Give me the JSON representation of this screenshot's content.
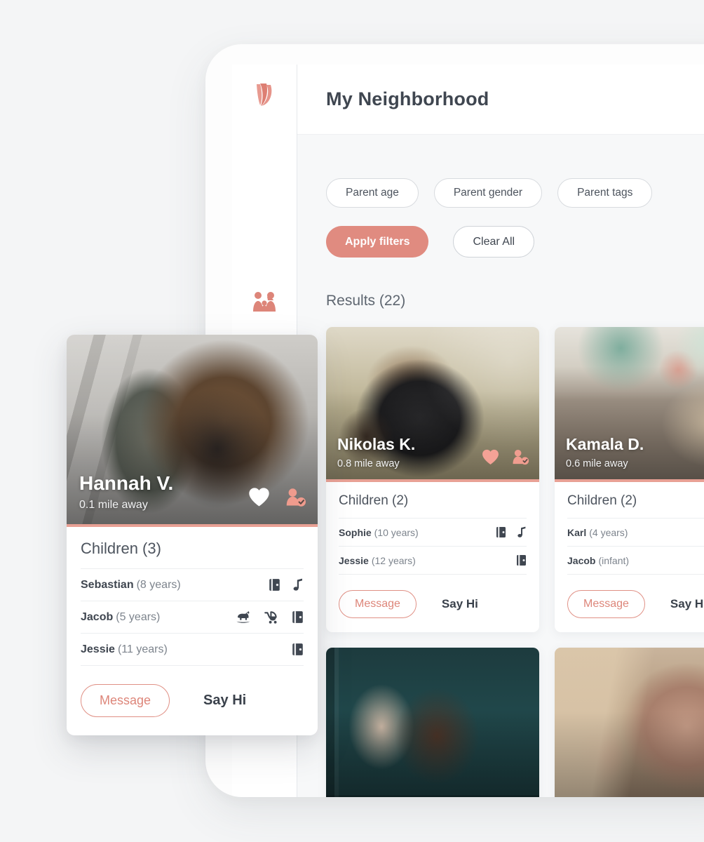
{
  "brand": {
    "accent": "#e08b80",
    "accent_soft": "#e8a094",
    "logo_icon": "tulip-logo-icon",
    "logo_alt": "Tulip logo"
  },
  "sidebar": {
    "items": [
      {
        "icon": "family-icon",
        "label": "Neighborhood",
        "active": true
      }
    ]
  },
  "header": {
    "title": "My Neighborhood"
  },
  "filters": {
    "chips": [
      {
        "label": "Parent age"
      },
      {
        "label": "Parent gender"
      },
      {
        "label": "Parent tags"
      }
    ],
    "apply_label": "Apply filters",
    "clear_label": "Clear All"
  },
  "results": {
    "heading": "Results (22)",
    "count": 22,
    "cards": [
      {
        "name": "Nikolas K.",
        "distance": "0.8 mile away",
        "scene": "scene-field",
        "favorited": true,
        "heart_color": "#f4a296",
        "verified": true,
        "children_heading": "Children (2)",
        "children": [
          {
            "name": "Sophie",
            "age": "(10 years)",
            "icons": [
              "book-icon",
              "music-note-icon"
            ]
          },
          {
            "name": "Jessie",
            "age": "(12 years)",
            "icons": [
              "book-icon"
            ]
          }
        ],
        "message_label": "Message",
        "sayhi_label": "Say Hi"
      },
      {
        "name": "Kamala D.",
        "distance": "0.6 mile away",
        "scene": "scene-livingroom",
        "favorited": false,
        "heart_color": "#ffffff",
        "verified": false,
        "children_heading": "Children (2)",
        "children": [
          {
            "name": "Karl",
            "age": "(4 years)",
            "icons": []
          },
          {
            "name": "Jacob",
            "age": "(infant)",
            "icons": []
          }
        ],
        "message_label": "Message",
        "sayhi_label": "Say Hi"
      },
      {
        "name": "",
        "distance": "",
        "scene": "scene-door",
        "favorited": false,
        "heart_color": "#ffffff",
        "verified": false,
        "children_heading": "",
        "children": [],
        "message_label": "",
        "sayhi_label": ""
      },
      {
        "name": "",
        "distance": "",
        "scene": "scene-portrait",
        "favorited": false,
        "heart_color": "#ffffff",
        "verified": false,
        "children_heading": "",
        "children": [],
        "message_label": "",
        "sayhi_label": ""
      }
    ]
  },
  "featured": {
    "name": "Hannah V.",
    "distance": "0.1 mile away",
    "scene": "scene-street",
    "favorited": true,
    "heart_color": "#ffffff",
    "verified": true,
    "children_heading": "Children (3)",
    "children": [
      {
        "name": "Sebastian",
        "age": "(8 years)",
        "icons": [
          "book-icon",
          "music-note-icon"
        ]
      },
      {
        "name": "Jacob",
        "age": "(5 years)",
        "icons": [
          "rocking-horse-icon",
          "stroller-icon",
          "book-icon"
        ]
      },
      {
        "name": "Jessie",
        "age": "(11 years)",
        "icons": [
          "book-icon"
        ]
      }
    ],
    "message_label": "Message",
    "sayhi_label": "Say Hi"
  }
}
